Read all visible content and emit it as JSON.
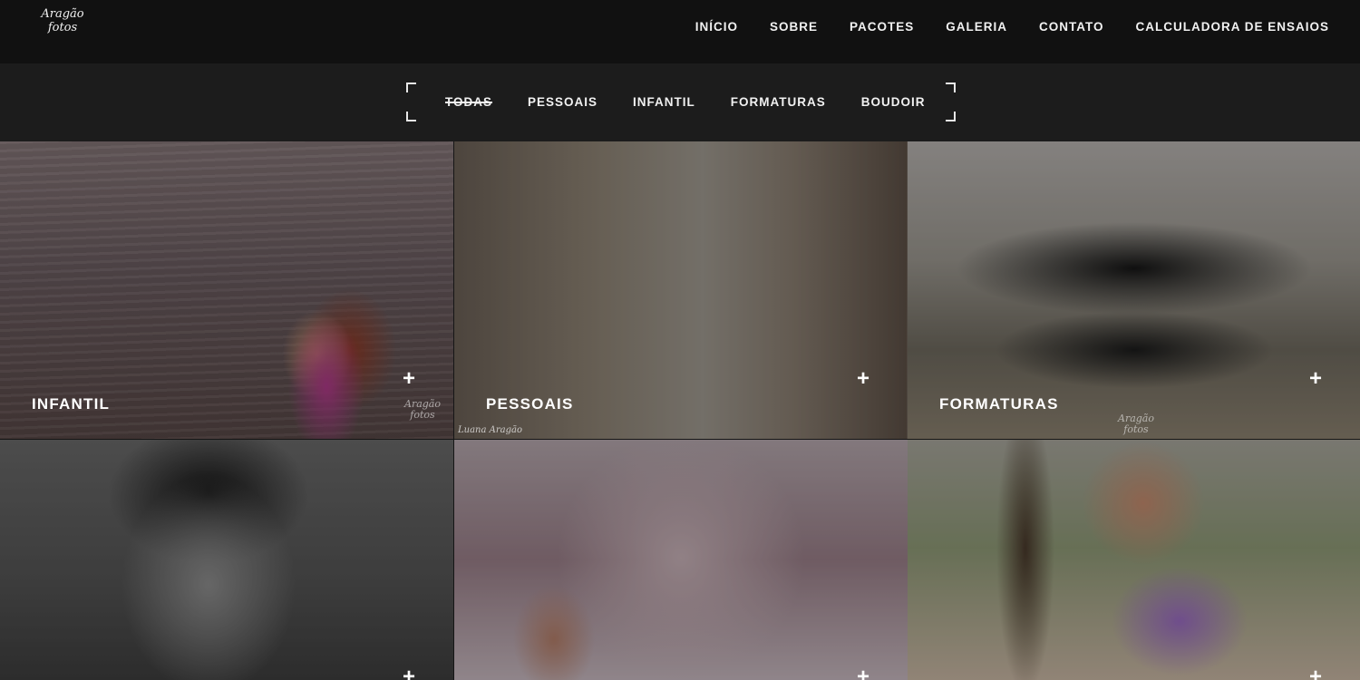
{
  "header": {
    "logo": {
      "line1": "Aragão",
      "line2": "fotos"
    },
    "nav": [
      {
        "label": "INÍCIO"
      },
      {
        "label": "SOBRE"
      },
      {
        "label": "PACOTES"
      },
      {
        "label": "GALERIA"
      },
      {
        "label": "CONTATO"
      },
      {
        "label": "CALCULADORA DE ENSAIOS"
      }
    ]
  },
  "filters": {
    "active": "TODAS",
    "items": [
      {
        "label": "TODAS"
      },
      {
        "label": "PESSOAIS"
      },
      {
        "label": "INFANTIL"
      },
      {
        "label": "FORMATURAS"
      },
      {
        "label": "BOUDOIR"
      }
    ]
  },
  "gallery": {
    "tiles": [
      {
        "caption": "INFANTIL",
        "icon": "plus-icon",
        "watermark": {
          "line1": "Aragão",
          "line2": "fotos"
        }
      },
      {
        "caption": "PESSOAIS",
        "icon": "plus-icon",
        "credit": "Luana Aragão"
      },
      {
        "caption": "FORMATURAS",
        "icon": "plus-icon",
        "watermark": {
          "line1": "Aragão",
          "line2": "fotos"
        }
      },
      {
        "caption": "",
        "icon": "plus-icon"
      },
      {
        "caption": "",
        "icon": "plus-icon"
      },
      {
        "caption": "",
        "icon": "plus-icon"
      }
    ],
    "plus_symbol": "+"
  }
}
